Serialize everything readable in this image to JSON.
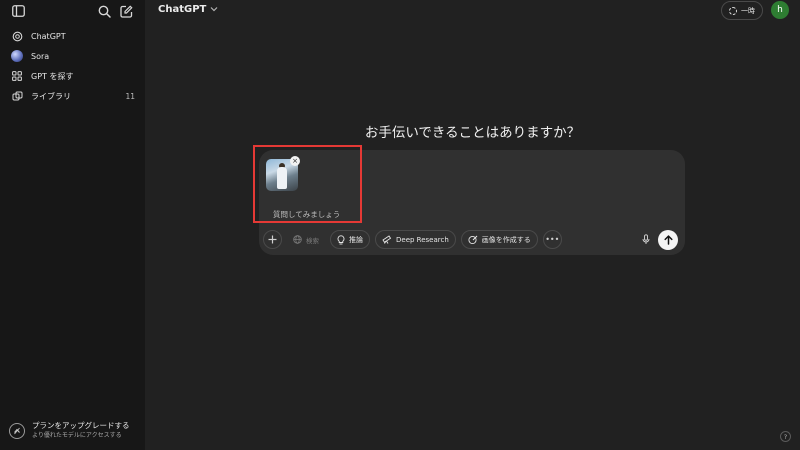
{
  "header": {
    "title": "ChatGPT",
    "temporary_label": "一時",
    "avatar_initial": "h"
  },
  "sidebar": {
    "items": [
      {
        "label": "ChatGPT",
        "icon": "chatgpt-logo-icon"
      },
      {
        "label": "Sora",
        "icon": "sora-icon"
      },
      {
        "label": "GPT を探す",
        "icon": "grid-icon"
      },
      {
        "label": "ライブラリ",
        "icon": "library-icon",
        "count": "11"
      }
    ],
    "upgrade": {
      "title": "プランをアップグレードする",
      "subtitle": "より優れたモデルにアクセスする"
    }
  },
  "main": {
    "heading": "お手伝いできることはありますか？"
  },
  "composer": {
    "placeholder": "質問してみましょう",
    "attachment": {
      "remove_symbol": "×"
    },
    "tools": {
      "search": "検索",
      "reason": "推論",
      "deep_research": "Deep Research",
      "create_image": "画像を作成する",
      "more": "•••"
    }
  },
  "help_label": "?",
  "colors": {
    "background": "#212121",
    "sidebar": "#171717",
    "composer": "#303030",
    "avatar": "#2e7d32",
    "highlight": "#e53935"
  }
}
